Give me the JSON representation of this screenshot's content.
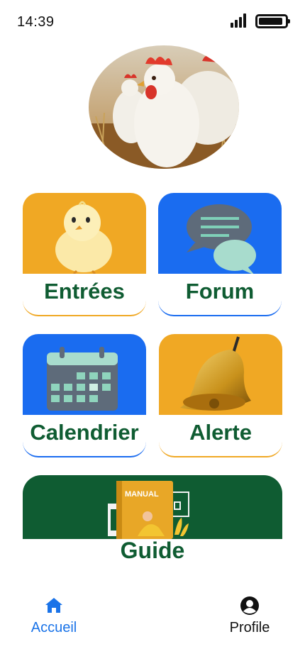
{
  "status": {
    "time": "14:39"
  },
  "cards": [
    {
      "label": "Entrées",
      "bg": "#F0A824",
      "accent": "#F0A824",
      "icon": "chick-icon"
    },
    {
      "label": "Forum",
      "bg": "#1A6CF0",
      "accent": "#1A6CF0",
      "icon": "chat-bubbles-icon"
    },
    {
      "label": "Calendrier",
      "bg": "#1A6CF0",
      "accent": "#1A6CF0",
      "icon": "calendar-icon"
    },
    {
      "label": "Alerte",
      "bg": "#F0A824",
      "accent": "#F0A824",
      "icon": "bell-icon"
    }
  ],
  "guide": {
    "label": "Guide",
    "bg": "#0F5C32",
    "book_title": "MANUAL",
    "icon": "manual-book-icon"
  },
  "nav": {
    "home_label": "Accueil",
    "profile_label": "Profile",
    "active_color": "#1A73E8"
  }
}
